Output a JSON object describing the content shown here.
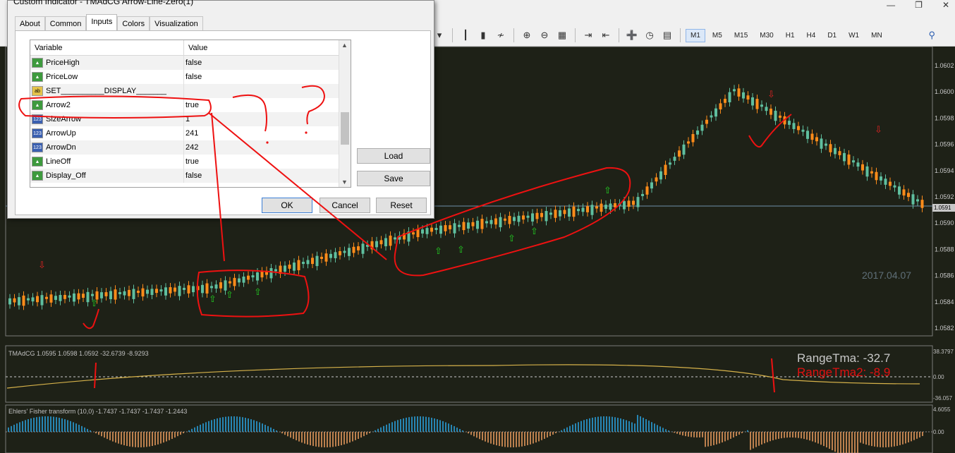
{
  "dialog": {
    "title": "Custom Indicator - TMAdCG Arrow-Line-Zero(1)",
    "tabs": [
      {
        "label": "About"
      },
      {
        "label": "Common"
      },
      {
        "label": "Inputs"
      },
      {
        "label": "Colors"
      },
      {
        "label": "Visualization"
      }
    ],
    "active_tab": "Inputs",
    "grid": {
      "col_variable": "Variable",
      "col_value": "Value",
      "rows": [
        {
          "icon": "bool",
          "name": "PriceHigh",
          "value": "false"
        },
        {
          "icon": "bool",
          "name": "PriceLow",
          "value": "false"
        },
        {
          "icon": "str",
          "name": "SET__________DISPLAY_______",
          "value": ""
        },
        {
          "icon": "bool",
          "name": "Arrow2",
          "value": "true"
        },
        {
          "icon": "int",
          "name": "SizeArrow",
          "value": "1"
        },
        {
          "icon": "int",
          "name": "ArrowUp",
          "value": "241"
        },
        {
          "icon": "int",
          "name": "ArrowDn",
          "value": "242"
        },
        {
          "icon": "bool",
          "name": "LineOff",
          "value": "true"
        },
        {
          "icon": "bool",
          "name": "Display_Off",
          "value": "false"
        }
      ]
    },
    "buttons": {
      "load": "Load",
      "save": "Save",
      "ok": "OK",
      "cancel": "Cancel",
      "reset": "Reset"
    }
  },
  "toolbar": {
    "timeframes": [
      "M1",
      "M5",
      "M15",
      "M30",
      "H1",
      "H4",
      "D1",
      "W1",
      "MN"
    ],
    "active_timeframe": "M1",
    "icons": [
      "dropdown-icon",
      "bar-chart-icon",
      "candlestick-icon",
      "line-chart-icon",
      "zoom-in-icon",
      "zoom-out-icon",
      "tile-icon",
      "autoscroll-icon",
      "chart-shift-icon",
      "add-indicator-icon",
      "clock-icon",
      "template-icon"
    ]
  },
  "chart": {
    "price_labels": [
      "1.0602",
      "1.0600",
      "1.0598",
      "1.0596",
      "1.0594",
      "1.0592",
      "1.0590",
      "1.0588",
      "1.0586",
      "1.0584",
      "1.0582"
    ],
    "current_price": "1.0591",
    "watermark_date": "2017.04.07",
    "indicator1": {
      "label": "TMAdCG 1.0595 1.0598 1.0592 -32.6739 -8.9293",
      "axis_labels": [
        "38.3797",
        "0.00",
        "-36.057"
      ],
      "range_tma_label": "RangeTma:",
      "range_tma_value": "-32.7",
      "range_tma2_label": "RangeTma2:",
      "range_tma2_value": "-8.9"
    },
    "indicator2": {
      "label": "Ehlers' Fisher transform (10,0) -1.7437 -1.7437 -1.7437 -1.2443",
      "axis_labels": [
        "4.6055",
        "0.00"
      ]
    },
    "colors": {
      "background": "#1e2117",
      "bull": "#5fbf9f",
      "bear": "#ff8c1a",
      "signal_up": "#22cc22",
      "signal_dn": "#dd2222",
      "tma_line": "#d6b24a",
      "fisher_pos": "#2aa8e8",
      "fisher_neg": "#f0a060",
      "annotation": "#ee1111"
    }
  }
}
